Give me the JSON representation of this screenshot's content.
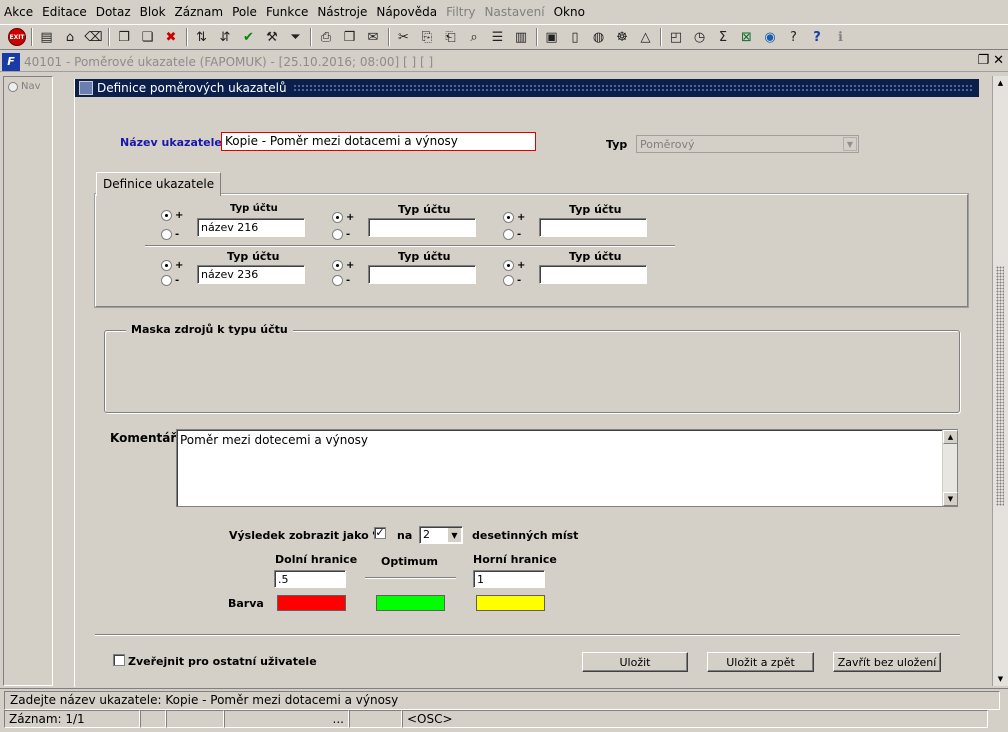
{
  "menu": [
    "Akce",
    "Editace",
    "Dotaz",
    "Blok",
    "Záznam",
    "Pole",
    "Funkce",
    "Nástroje",
    "Nápověda",
    "Filtry",
    "Nastavení",
    "Okno"
  ],
  "menu_disabled": [
    "Filtry",
    "Nastavení"
  ],
  "toolbar": {
    "exit_label": "EXIT",
    "icons": [
      "exit-icon",
      "insert-record-icon",
      "save-icon",
      "clear-icon",
      "query-icon",
      "execute-query-icon",
      "delete-icon",
      "sort-asc-icon",
      "sort-desc-icon",
      "accept-icon",
      "tools-icon",
      "filter-icon",
      "print-icon",
      "print-preview-icon",
      "mail-icon",
      "cut-icon",
      "copy-icon",
      "paste-icon",
      "find-icon",
      "list-icon",
      "columns-icon",
      "clipboard-icon",
      "document-icon",
      "globe-icon",
      "settings-wheel-icon",
      "triangle-icon",
      "chart-icon",
      "calculator-icon",
      "sum-icon",
      "excel-icon",
      "web-icon",
      "help-context-icon",
      "help-icon",
      "info-icon"
    ]
  },
  "window": {
    "title": "40101 - Poměrové ukazatele (FAPOMUK) - [25.10.2016; 08:00]  [ ]  [ ]",
    "logo": "F"
  },
  "nav": {
    "label": "Nav"
  },
  "panel": {
    "title": "Definice poměrových ukazatelů"
  },
  "form": {
    "name_label": "Název ukazatele",
    "name_value": "Kopie - Poměr mezi dotacemi a výnosy",
    "type_label": "Typ",
    "type_value": "Poměrový",
    "tab_label": "Definice ukazatele",
    "account_type_label": "Typ účtu",
    "plus": "+",
    "minus": "-",
    "row1": [
      "název 216",
      "",
      ""
    ],
    "row2": [
      "název 236",
      "",
      ""
    ],
    "mask_label": "Maska zdrojů k typu účtu",
    "comment_label": "Komentář",
    "comment_value": "Poměr mezi dotecemi a výnosy",
    "percent_label": "Výsledek zobrazit jako %",
    "percent_checked": "✓",
    "on_label": "na",
    "decimals_value": "2",
    "decimals_label": "desetinných míst",
    "lower_label": "Dolní hranice",
    "optimum_label": "Optimum",
    "upper_label": "Horní hranice",
    "lower_value": ".5",
    "upper_value": "1",
    "color_label": "Barva",
    "colors": {
      "lower": "#ff0000",
      "optimum": "#00ff00",
      "upper": "#ffff00"
    },
    "publish_label": "Zveřejnit pro ostatní uživatele"
  },
  "buttons": {
    "save": "Uložit",
    "save_back": "Uložit a zpět",
    "close_nosave": "Zavřít bez uložení"
  },
  "status": {
    "message": "Zadejte název ukazatele: Kopie - Poměr mezi dotacemi a výnosy",
    "record": "Záznam: 1/1",
    "ellipsis": "...",
    "osc": "<OSC>"
  }
}
